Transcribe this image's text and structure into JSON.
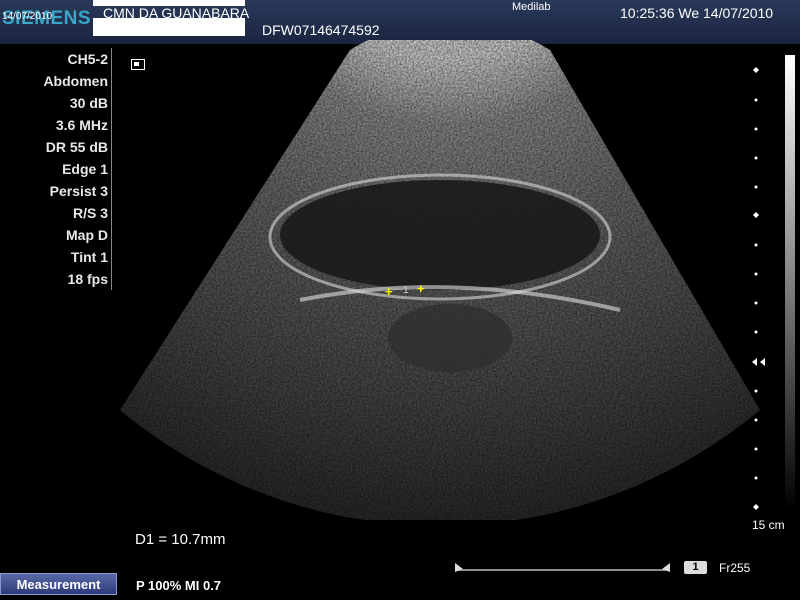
{
  "header": {
    "logo_date": "14/07/2010",
    "logo_text": "SIEMENS",
    "hospital": "CMN DA GUANABARA",
    "patient_id": "DFW07146474592",
    "system": "Medilab",
    "clock": "10:25:36  We  14/07/2010"
  },
  "params": [
    "CH5-2",
    "Abdomen",
    "30 dB",
    "3.6 MHz",
    "DR 55 dB",
    "Edge 1",
    "Persist 3",
    "R/S 3",
    "Map D",
    "Tint 1",
    "18 fps"
  ],
  "image": {
    "caliper_label": "1"
  },
  "depth": {
    "label": "15 cm"
  },
  "measurement": {
    "text": "D1 = 10.7mm"
  },
  "power": {
    "text": "P 100%   MI 0.7"
  },
  "buttons": {
    "measurement": "Measurement"
  },
  "cine": {
    "index": "1",
    "frame": "Fr255"
  },
  "colors": {
    "header": "#1a2440",
    "logo": "#3aa6c8",
    "caliper": "#ffff00",
    "button": "#2d3a7a"
  }
}
